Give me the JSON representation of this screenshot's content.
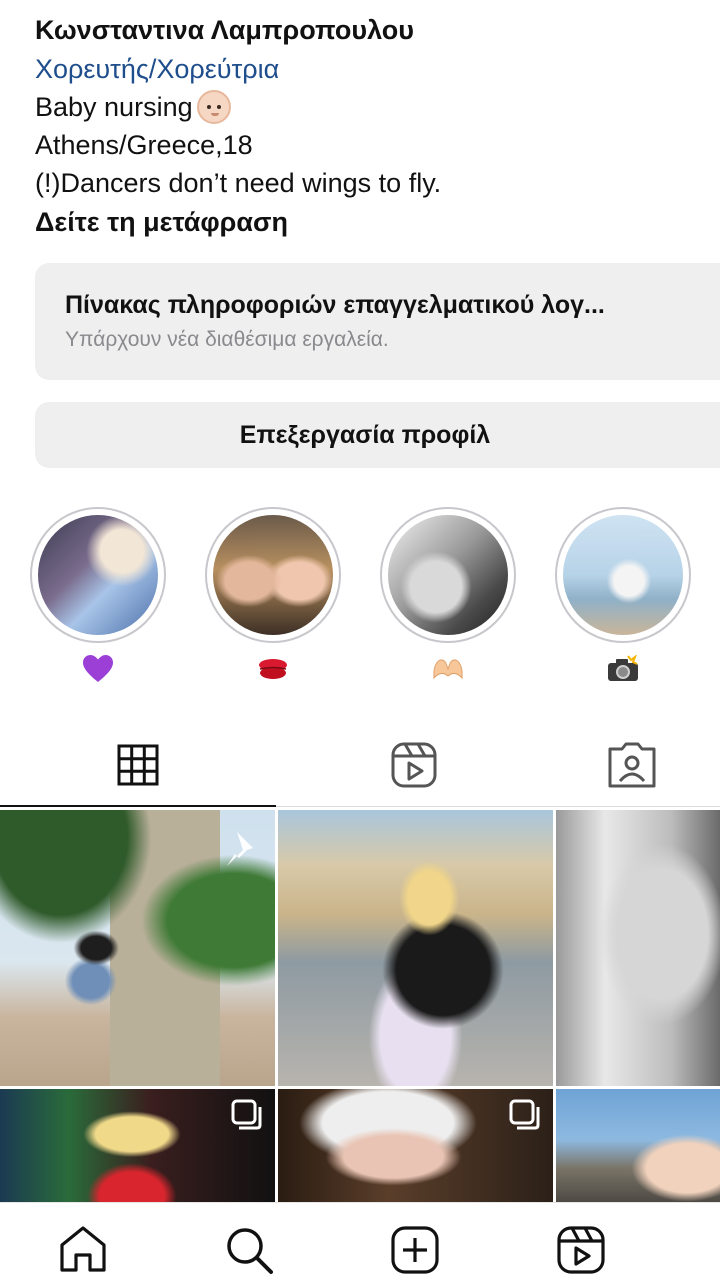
{
  "profile": {
    "name": "Κωνσταντινα Λαμπροπουλου",
    "category": "Χορευτής/Χορεύτρια",
    "bio_line_1": "Baby nursing",
    "bio_line_1_emoji": "baby-face-icon",
    "bio_line_2": "Athens/Greece,18",
    "bio_line_3": "(!)Dancers don’t need wings to fly.",
    "see_translation": "Δείτε τη μετάφραση"
  },
  "dashboard": {
    "title": "Πίνακας πληροφοριών επαγγελματικού λογ...",
    "subtitle": "Υπάρχουν νέα διαθέσιμα εργαλεία."
  },
  "edit_profile_label": "Επεξεργασία προφίλ",
  "highlights": [
    {
      "icon": "purple-heart-icon"
    },
    {
      "icon": "kiss-mark-icon"
    },
    {
      "icon": "heart-hands-icon"
    },
    {
      "icon": "camera-flash-icon"
    }
  ],
  "tabs": [
    {
      "icon": "grid-icon",
      "active": true
    },
    {
      "icon": "reels-icon",
      "active": false
    },
    {
      "icon": "tagged-icon",
      "active": false
    }
  ],
  "grid_posts": [
    {
      "type": "pinned",
      "icon": "pin-icon"
    },
    {
      "type": "photo"
    },
    {
      "type": "photo"
    },
    {
      "type": "carousel",
      "icon": "multiple-posts-icon"
    },
    {
      "type": "carousel",
      "icon": "multiple-posts-icon"
    },
    {
      "type": "photo"
    }
  ],
  "bottom_nav": [
    {
      "icon": "home-icon"
    },
    {
      "icon": "search-icon"
    },
    {
      "icon": "create-icon"
    },
    {
      "icon": "reels-icon"
    }
  ],
  "colors": {
    "category_link": "#1f4e8c",
    "button_bg": "#efeff0",
    "muted_text": "#8a8a8e"
  }
}
